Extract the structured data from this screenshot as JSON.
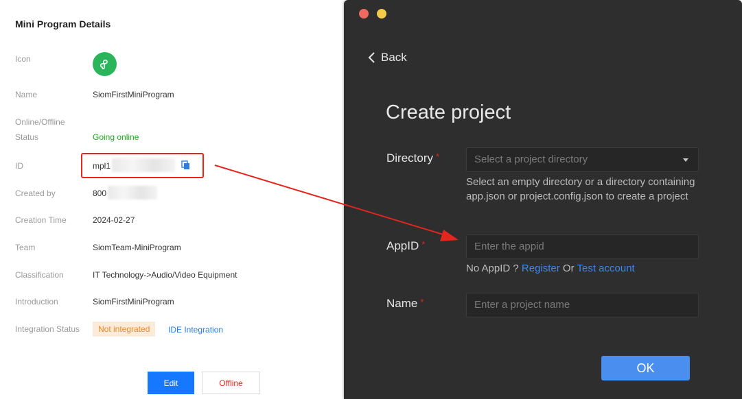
{
  "details": {
    "title": "Mini Program Details",
    "rows": {
      "icon_label": "Icon",
      "name_label": "Name",
      "name_value": "SiomFirstMiniProgram",
      "status_label_line1": "Online/Offline",
      "status_label_line2": "Status",
      "status_value": "Going online",
      "id_label": "ID",
      "id_value": "mpl1",
      "created_by_label": "Created by",
      "created_by_value": "800",
      "creation_time_label": "Creation Time",
      "creation_time_value": "2024-02-27",
      "team_label": "Team",
      "team_value": "SiomTeam-MiniProgram",
      "classification_label": "Classification",
      "classification_value": "IT Technology->Audio/Video Equipment",
      "introduction_label": "Introduction",
      "introduction_value": "SiomFirstMiniProgram",
      "integration_label": "Integration Status",
      "integration_tag": "Not integrated",
      "integration_link": "IDE Integration"
    },
    "buttons": {
      "edit": "Edit",
      "offline": "Offline"
    }
  },
  "dialog": {
    "back": "Back",
    "title": "Create project",
    "directory_label": "Directory",
    "directory_placeholder": "Select a project directory",
    "directory_help": "Select an empty directory or a directory containing app.json or project.config.json to create a project",
    "appid_label": "AppID",
    "appid_placeholder": "Enter the appid",
    "no_appid_prefix": "No AppID ?",
    "register_link": "Register",
    "or_text": "Or",
    "test_account_link": "Test account",
    "name_label": "Name",
    "name_placeholder": "Enter a project name",
    "required_mark": "*",
    "ok_button": "OK"
  },
  "icons": {
    "app": "mini-program-logo-icon",
    "copy": "copy-icon",
    "back": "chevron-left-icon",
    "dropdown": "caret-down-icon"
  },
  "colors": {
    "accent_blue": "#1677ff",
    "dialog_bg": "#2e2e2e",
    "status_green": "#1aad19",
    "highlight_red": "#e5251e"
  }
}
